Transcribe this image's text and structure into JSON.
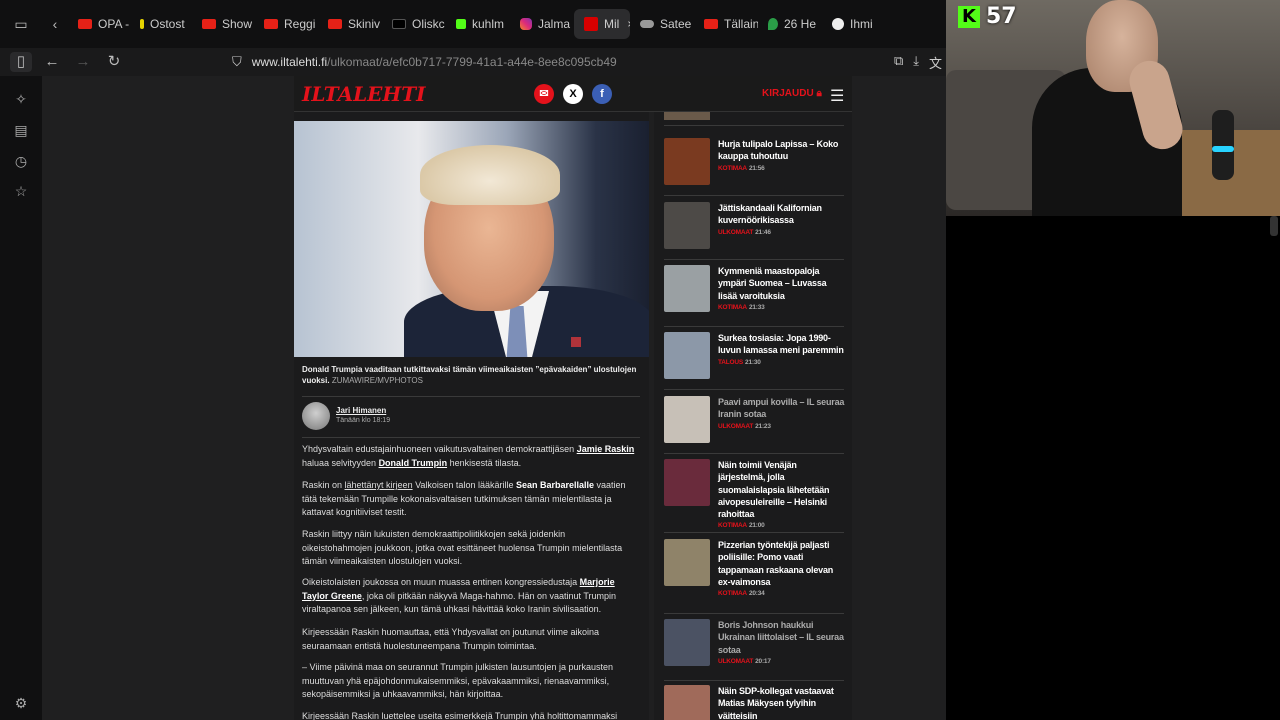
{
  "tabs": [
    {
      "label": "OPA -",
      "favicon": "youtube"
    },
    {
      "label": "Ostost",
      "favicon": "yellow"
    },
    {
      "label": "Show",
      "favicon": "youtube"
    },
    {
      "label": "Reggi",
      "favicon": "youtube"
    },
    {
      "label": "Skiniv",
      "favicon": "youtube"
    },
    {
      "label": "Oliskc",
      "favicon": "tiktok"
    },
    {
      "label": "kuhlm",
      "favicon": "kick"
    },
    {
      "label": "Jalma",
      "favicon": "instagram"
    },
    {
      "label": "Mil",
      "favicon": "iltalehti",
      "active": true
    },
    {
      "label": "Satee",
      "favicon": "cloud"
    },
    {
      "label": "Tällain",
      "favicon": "youtube"
    },
    {
      "label": "26 He",
      "favicon": "maps"
    },
    {
      "label": "Ihmi",
      "favicon": "github"
    }
  ],
  "address": {
    "domain": "www.iltalehti.fi",
    "path": "/ulkomaat/a/efc0b717-7799-41a1-a44e-8ee8c095cb49"
  },
  "site": {
    "logo": "ILTALEHTI",
    "login": "KIRJAUDU",
    "share": [
      "✉",
      "X",
      "f"
    ]
  },
  "article": {
    "caption": "Donald Trumpia vaaditaan tutkittavaksi tämän viimeaikaisten ”epävakaiden” ulostulojen vuoksi.",
    "caption_source": "ZUMAWIRE/MVPHOTOS",
    "author": "Jari Himanen",
    "time": "Tänään klo 18:19",
    "p1_a": "Yhdysvaltain edustajainhuoneen vaikutusvaltainen demokraattijäsen ",
    "p1_link1": "Jamie Raskin",
    "p1_b": " haluaa selvityyden ",
    "p1_link2": "Donald Trumpin",
    "p1_c": " henkisestä tilasta.",
    "p2_a": "Raskin on ",
    "p2_link": "lähettänyt kirjeen",
    "p2_b": " Valkoisen talon lääkärille ",
    "p2_bold": "Sean Barbarellalle",
    "p2_c": " vaatien tätä tekemään Trumpille kokonaisvaltaisen tutkimuksen tämän mielentilasta ja kattavat kognitiiviset testit.",
    "p3": "Raskin liittyy näin lukuisten demokraattipoliitikkojen sekä joidenkin oikeistohahmojen joukkoon, jotka ovat esittäneet huolensa Trumpin mielentilasta tämän viimeaikaisten ulostulojen vuoksi.",
    "p4_a": "Oikeistolaisten joukossa on muun muassa entinen kongressiedustaja ",
    "p4_link": "Marjorie Taylor Greene",
    "p4_b": ", joka oli pitkään näkyvä Maga-hahmo. Hän on vaatinut Trumpin viraltapanoa sen jälkeen, kun tämä uhkasi hävittää koko Iranin sivilisaation.",
    "p5": "Kirjeessään Raskin huomauttaa, että Yhdysvallat on joutunut viime aikoina seuraamaan entistä huolestuneempana Trumpin toimintaa.",
    "p6": "– Viime päivinä maa on seurannut Trumpin julkisten lausuntojen ja purkausten muuttuvan yhä epäjohdonmukaisemmiksi, epävakaammiksi, rienaavammiksi, sekopäisemmiksi ja uhkaavammiksi, hän kirjoittaa.",
    "p7": "Kirjeessään Raskin luettelee useita esimerkkejä Trumpin yhä holtittomammaksi"
  },
  "rail": [
    {
      "title": "Hurja tulipalo Lapissa – Koko kauppa tuhoutuu",
      "section": "KOTIMAA",
      "time": "21:56",
      "color": "#7a3a20"
    },
    {
      "title": "Jättiskandaali Kalifornian kuvernöörikisassa",
      "section": "ULKOMAAT",
      "time": "21:46",
      "color": "#4d4a47"
    },
    {
      "title": "Kymmeniä maastopaloja ympäri Suomea – Luvassa lisää varoituksia",
      "section": "KOTIMAA",
      "time": "21:33",
      "color": "#9aa0a3"
    },
    {
      "title": "Surkea tosiasia: Jopa 1990-luvun lamassa meni paremmin",
      "section": "TALOUS",
      "time": "21:30",
      "color": "#8c98a8"
    },
    {
      "title": "Paavi ampui kovilla – IL seuraa Iranin sotaa",
      "section": "ULKOMAAT",
      "time": "21:23",
      "color": "#c7c0b7",
      "dim": true
    },
    {
      "title": "Näin toimii Venäjän järjestelmä, jolla suomalaislapsia lähetetään aivopesuleireille – Helsinki rahoittaa",
      "section": "KOTIMAA",
      "time": "21:00",
      "color": "#6a2b3c"
    },
    {
      "title": "Pizzerian työntekijä paljasti poliisille: Pomo vaati tappamaan raskaana olevan ex-vaimonsa",
      "section": "KOTIMAA",
      "time": "20:34",
      "color": "#8f8369"
    },
    {
      "title": "Boris Johnson haukkui Ukrainan liittolaiset – IL seuraa sotaa",
      "section": "ULKOMAAT",
      "time": "20:17",
      "color": "#4b5263",
      "dim": true
    },
    {
      "title": "Näin SDP-kollegat vastaavat Matias Mäkysen tylyihin väitteisiin",
      "section": "",
      "time": "",
      "color": "#a06a5a"
    }
  ],
  "stream": {
    "viewer_count": "57",
    "platform_letter": "K"
  }
}
